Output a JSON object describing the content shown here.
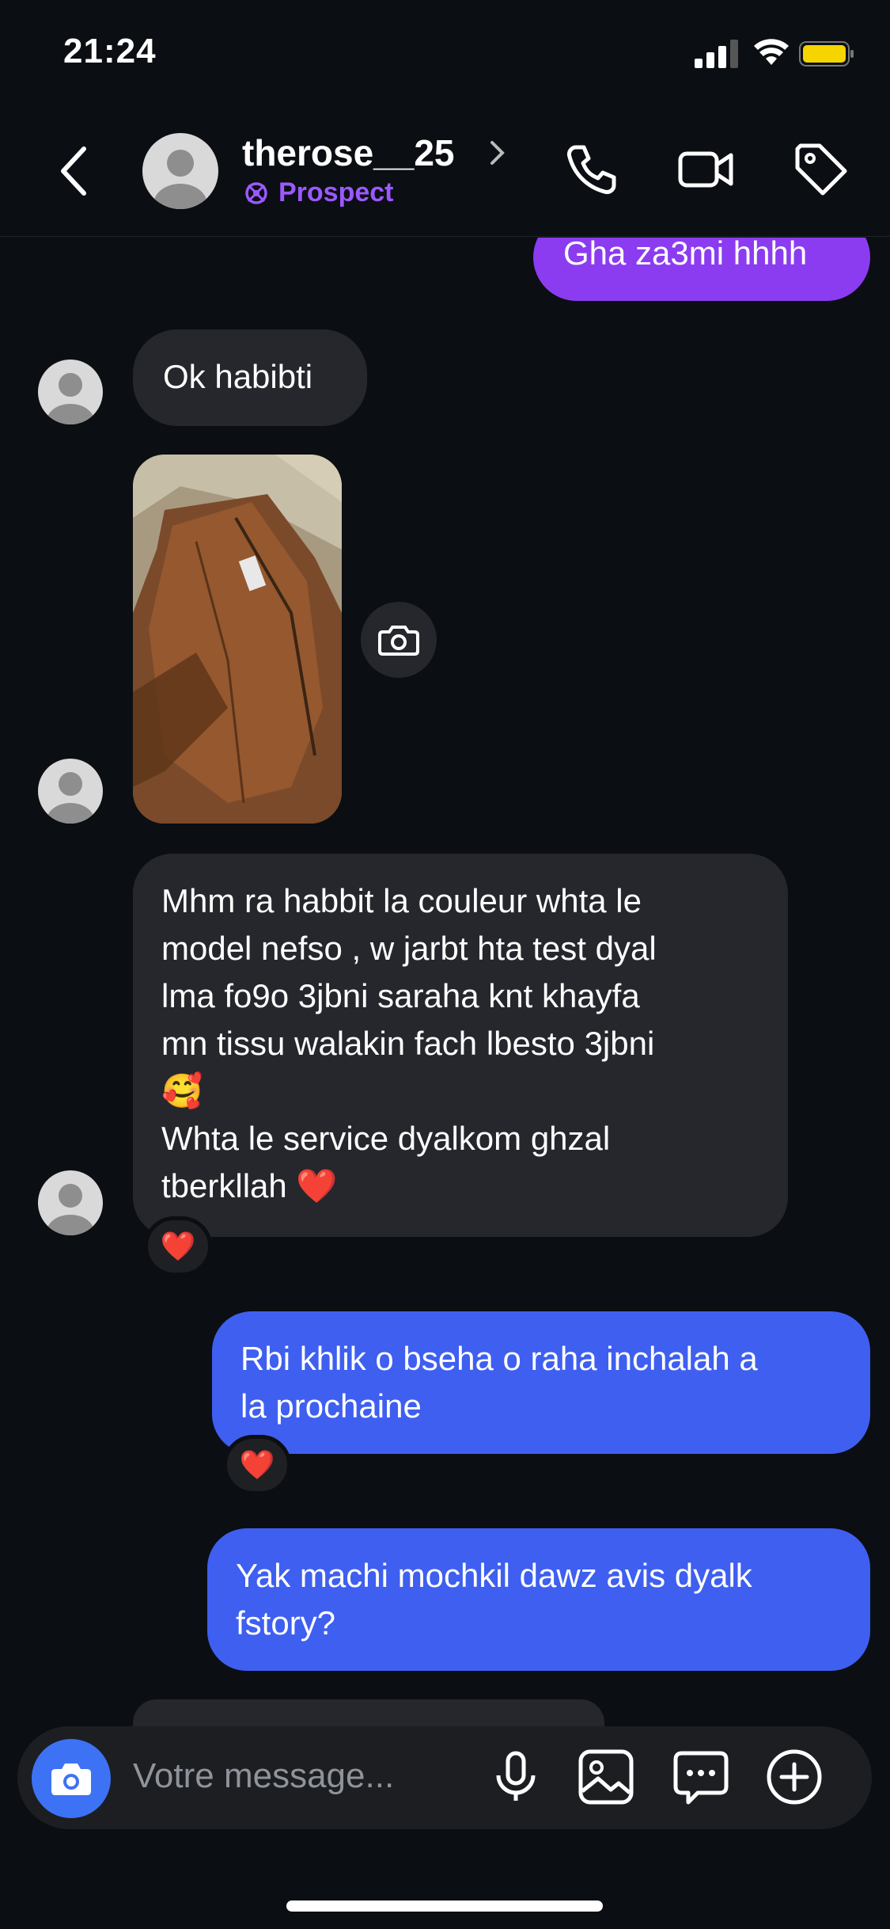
{
  "status_bar": {
    "time": "21:24"
  },
  "header": {
    "username": "therose__25",
    "label": "Prospect",
    "back_icon": "chevron-left-icon",
    "actions": [
      "phone-icon",
      "video-icon",
      "tag-icon"
    ]
  },
  "messages": {
    "top_outgoing": "Gha za3mi hhhh",
    "m1": "Ok habibti",
    "m2_lines": [
      "Mhm ra habbit la couleur whta le",
      "model nefso , w jarbt hta test dyal",
      "lma fo9o 3jbni saraha knt khayfa",
      "mn tissu walakin fach lbesto 3jbni",
      "🥰",
      "Whta le service dyalkom ghzal",
      "tberkllah ❤️"
    ],
    "m2_reaction": "❤️",
    "m3": "Rbi khlik o bseha o raha inchalah a\nla prochaine",
    "m3_reaction": "❤️",
    "m4": "Yak machi mochkil dawz avis dyalk\nfstory?"
  },
  "composer": {
    "placeholder": "Votre message...",
    "icons": [
      "camera-icon",
      "microphone-icon",
      "gallery-icon",
      "sticker-icon",
      "plus-icon"
    ]
  },
  "colors": {
    "background": "#0b0e13",
    "incoming": "#25272c",
    "outgoing_purple": "#8b3cf0",
    "outgoing_blue": "#3e5ff0",
    "accent": "#9b59ff"
  }
}
